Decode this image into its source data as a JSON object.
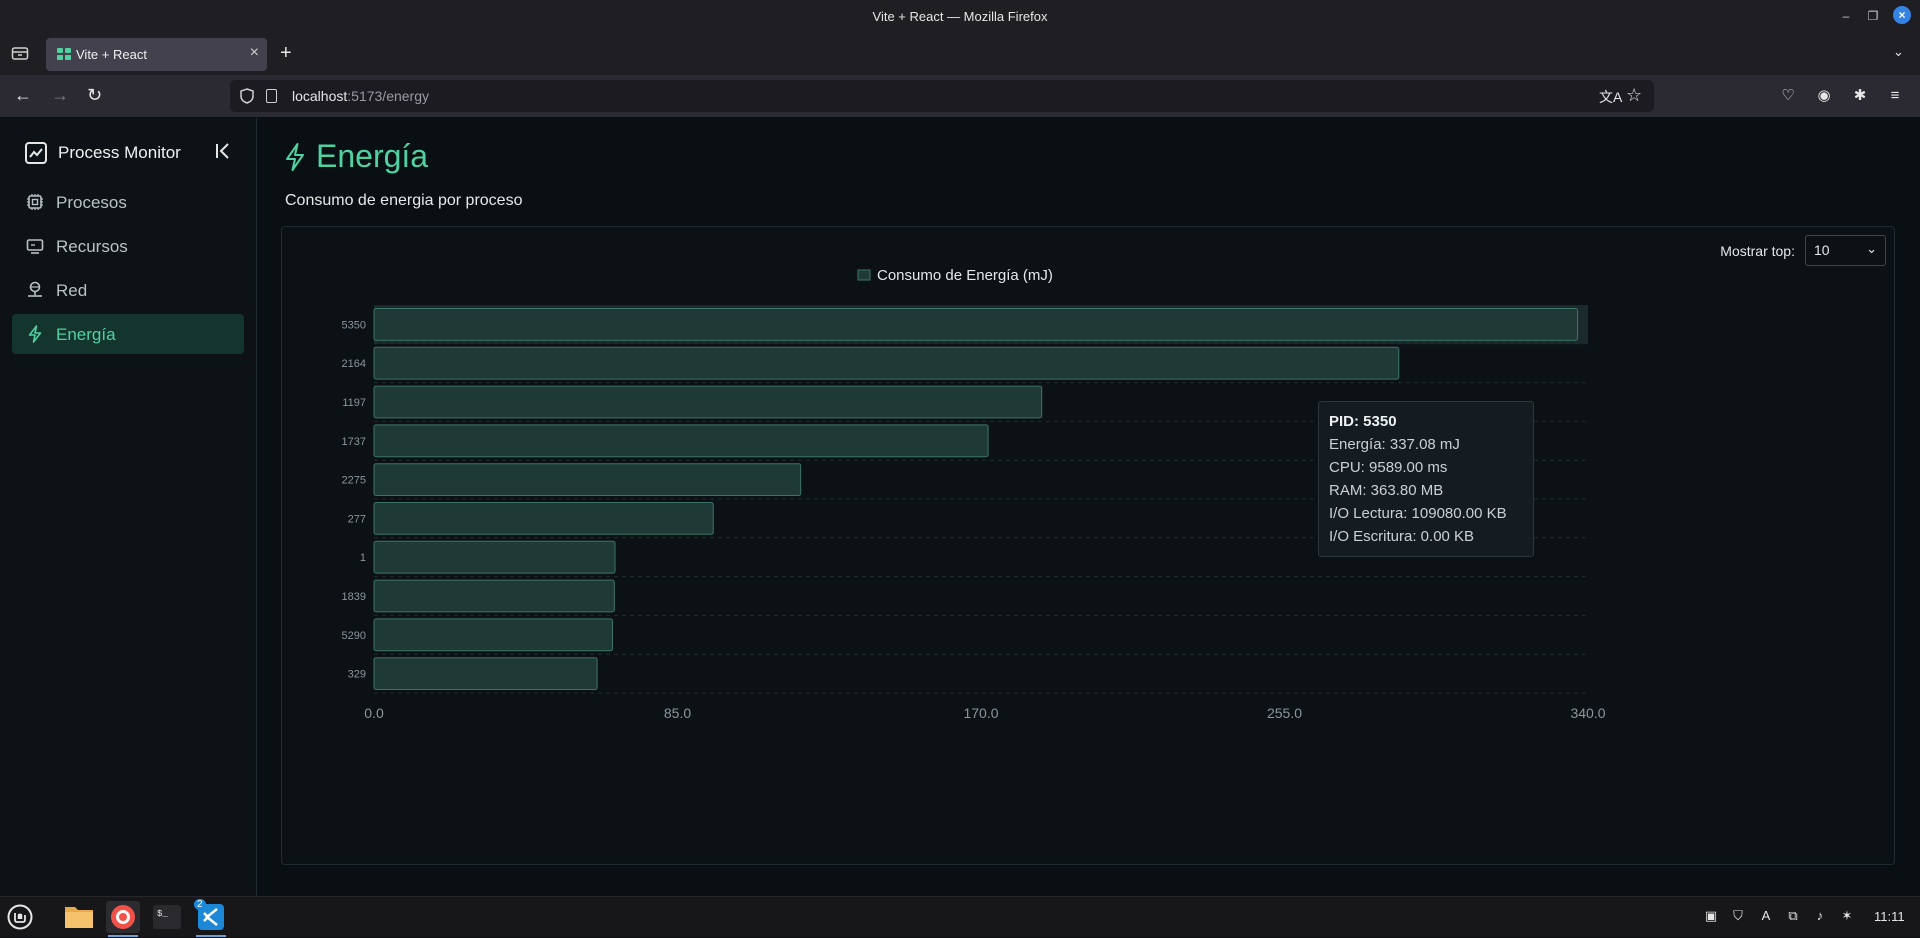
{
  "window": {
    "title": "Vite + React — Mozilla Firefox"
  },
  "browser": {
    "tab_title": "Vite + React",
    "url_host": "localhost",
    "url_rest": ":5173/energy"
  },
  "sidebar": {
    "brand": "Process Monitor",
    "items": [
      {
        "label": "Procesos",
        "icon": "cpu-icon"
      },
      {
        "label": "Recursos",
        "icon": "monitor-icon"
      },
      {
        "label": "Red",
        "icon": "network-icon"
      },
      {
        "label": "Energía",
        "icon": "bolt-icon",
        "active": true
      }
    ]
  },
  "page": {
    "title": "Energía",
    "subtitle": "Consumo de energia por proceso",
    "top_label": "Mostrar top:",
    "top_value": "10"
  },
  "chart_data": {
    "type": "bar",
    "orientation": "horizontal",
    "categories": [
      "5350",
      "2164",
      "1197",
      "1737",
      "2275",
      "277",
      "1",
      "1839",
      "5290",
      "329"
    ],
    "series": [
      {
        "name": "Consumo de Energía (mJ)",
        "values": [
          337.08,
          287,
          187,
          172,
          119.5,
          95,
          67.5,
          67.3,
          66.8,
          62.5
        ]
      }
    ],
    "xlim": [
      0,
      340
    ],
    "xticks": [
      "0.0",
      "85.0",
      "170.0",
      "255.0",
      "340.0"
    ],
    "legend_position": "top-center",
    "grid": "horizontal-dashed",
    "colors": {
      "bar_fill": "#1f3a36",
      "bar_stroke": "#3c7564",
      "highlight": "#1b2a2c"
    }
  },
  "tooltip": {
    "pid": "PID: 5350",
    "energia": "Energía: 337.08 mJ",
    "cpu": "CPU: 9589.00 ms",
    "ram": "RAM: 363.80 MB",
    "io_read": "I/O Lectura: 109080.00 KB",
    "io_write": "I/O Escritura: 0.00 KB"
  },
  "taskbar": {
    "clock": "11:11",
    "vscode_badge": "2"
  }
}
